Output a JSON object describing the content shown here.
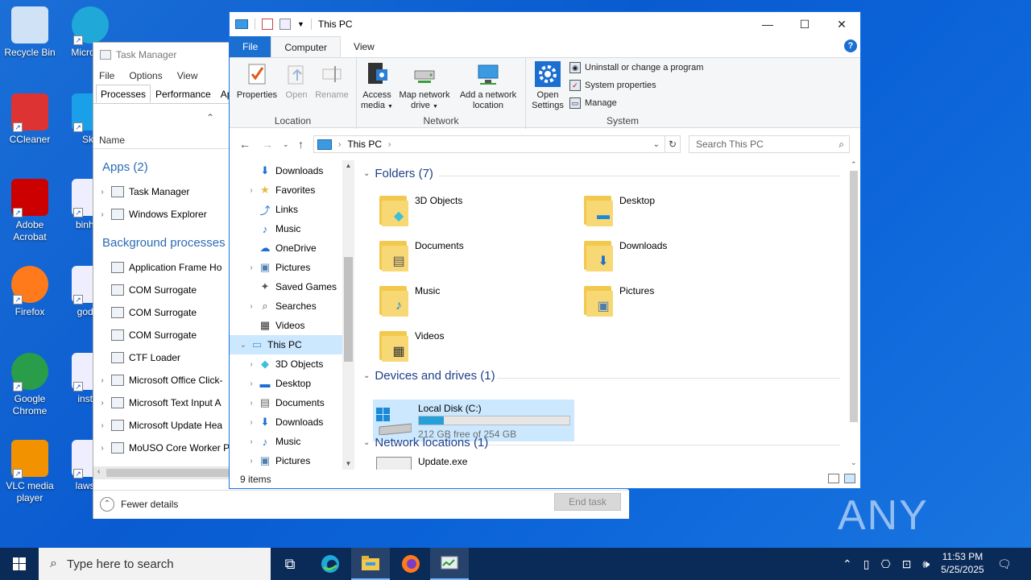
{
  "desktop": {
    "icons": [
      {
        "label": "Recycle Bin",
        "icon": "recycle-bin-icon"
      },
      {
        "label": "Micro Ed",
        "icon": "edge-icon"
      },
      {
        "label": "CCleaner",
        "icon": "ccleaner-icon"
      },
      {
        "label": "Sky",
        "icon": "skype-icon"
      },
      {
        "label": "Adobe Acrobat",
        "icon": "acrobat-icon"
      },
      {
        "label": "binhap",
        "icon": "file-icon"
      },
      {
        "label": "Firefox",
        "icon": "firefox-icon"
      },
      {
        "label": "godim",
        "icon": "file-icon"
      },
      {
        "label": "Google Chrome",
        "icon": "chrome-icon"
      },
      {
        "label": "institu",
        "icon": "file-icon"
      },
      {
        "label": "VLC media player",
        "icon": "vlc-icon"
      },
      {
        "label": "lawsco",
        "icon": "file-icon"
      }
    ],
    "watermark": "ANY RUN"
  },
  "task_manager": {
    "title": "Task Manager",
    "menu": [
      "File",
      "Options",
      "View"
    ],
    "tabs": [
      "Processes",
      "Performance",
      "App"
    ],
    "column_name": "Name",
    "apps_header": "Apps (2)",
    "apps": [
      "Task Manager",
      "Windows Explorer"
    ],
    "bg_header": "Background processes",
    "background": [
      "Application Frame Ho",
      "COM Surrogate",
      "COM Surrogate",
      "COM Surrogate",
      "CTF Loader",
      "Microsoft Office Click-",
      "Microsoft Text Input A",
      "Microsoft Update Hea",
      "MoUSO Core Worker P"
    ],
    "fewer_details": "Fewer details",
    "end_task": "End task"
  },
  "explorer": {
    "title": "This PC",
    "tabs": {
      "file": "File",
      "computer": "Computer",
      "view": "View"
    },
    "ribbon": {
      "location": {
        "name": "Location",
        "properties": "Properties",
        "open": "Open",
        "rename": "Rename"
      },
      "network": {
        "name": "Network",
        "access_media_1": "Access",
        "access_media_2": "media",
        "map_drive_1": "Map network",
        "map_drive_2": "drive",
        "add_location_1": "Add a network",
        "add_location_2": "location"
      },
      "system": {
        "name": "System",
        "open_settings_1": "Open",
        "open_settings_2": "Settings",
        "uninstall": "Uninstall or change a program",
        "sys_props": "System properties",
        "manage": "Manage"
      }
    },
    "address": "This PC",
    "search_placeholder": "Search This PC",
    "nav": [
      {
        "label": "Downloads",
        "icon": "download-icon",
        "exp": ""
      },
      {
        "label": "Favorites",
        "icon": "star-icon",
        "exp": ">"
      },
      {
        "label": "Links",
        "icon": "link-icon",
        "exp": ""
      },
      {
        "label": "Music",
        "icon": "music-icon",
        "exp": ""
      },
      {
        "label": "OneDrive",
        "icon": "cloud-icon",
        "exp": ""
      },
      {
        "label": "Pictures",
        "icon": "picture-icon",
        "exp": ">"
      },
      {
        "label": "Saved Games",
        "icon": "gamepad-icon",
        "exp": ""
      },
      {
        "label": "Searches",
        "icon": "search-icon",
        "exp": ">"
      },
      {
        "label": "Videos",
        "icon": "video-icon",
        "exp": ""
      },
      {
        "label": "This PC",
        "icon": "computer-icon",
        "exp": "v"
      },
      {
        "label": "3D Objects",
        "icon": "cube-icon",
        "exp": ">"
      },
      {
        "label": "Desktop",
        "icon": "desktop-icon",
        "exp": ">"
      },
      {
        "label": "Documents",
        "icon": "document-icon",
        "exp": ">"
      },
      {
        "label": "Downloads",
        "icon": "download-icon",
        "exp": ">"
      },
      {
        "label": "Music",
        "icon": "music-icon",
        "exp": ">"
      },
      {
        "label": "Pictures",
        "icon": "picture-icon",
        "exp": ">"
      }
    ],
    "folders_header": "Folders (7)",
    "folders": [
      {
        "label": "3D Objects",
        "badge": "cube-icon"
      },
      {
        "label": "Desktop",
        "badge": "desktop-icon"
      },
      {
        "label": "Documents",
        "badge": "document-icon"
      },
      {
        "label": "Downloads",
        "badge": "download-icon"
      },
      {
        "label": "Music",
        "badge": "music-icon"
      },
      {
        "label": "Pictures",
        "badge": "picture-icon"
      },
      {
        "label": "Videos",
        "badge": "video-icon"
      }
    ],
    "devices_header": "Devices and drives (1)",
    "drive": {
      "name": "Local Disk (C:)",
      "free": "212 GB free of 254 GB",
      "used_fraction": 0.165
    },
    "network_header": "Network locations (1)",
    "network_item": "Update.exe",
    "status": "9 items"
  },
  "taskbar": {
    "search_placeholder": "Type here to search",
    "time": "11:53 PM",
    "date": "5/25/2025"
  }
}
